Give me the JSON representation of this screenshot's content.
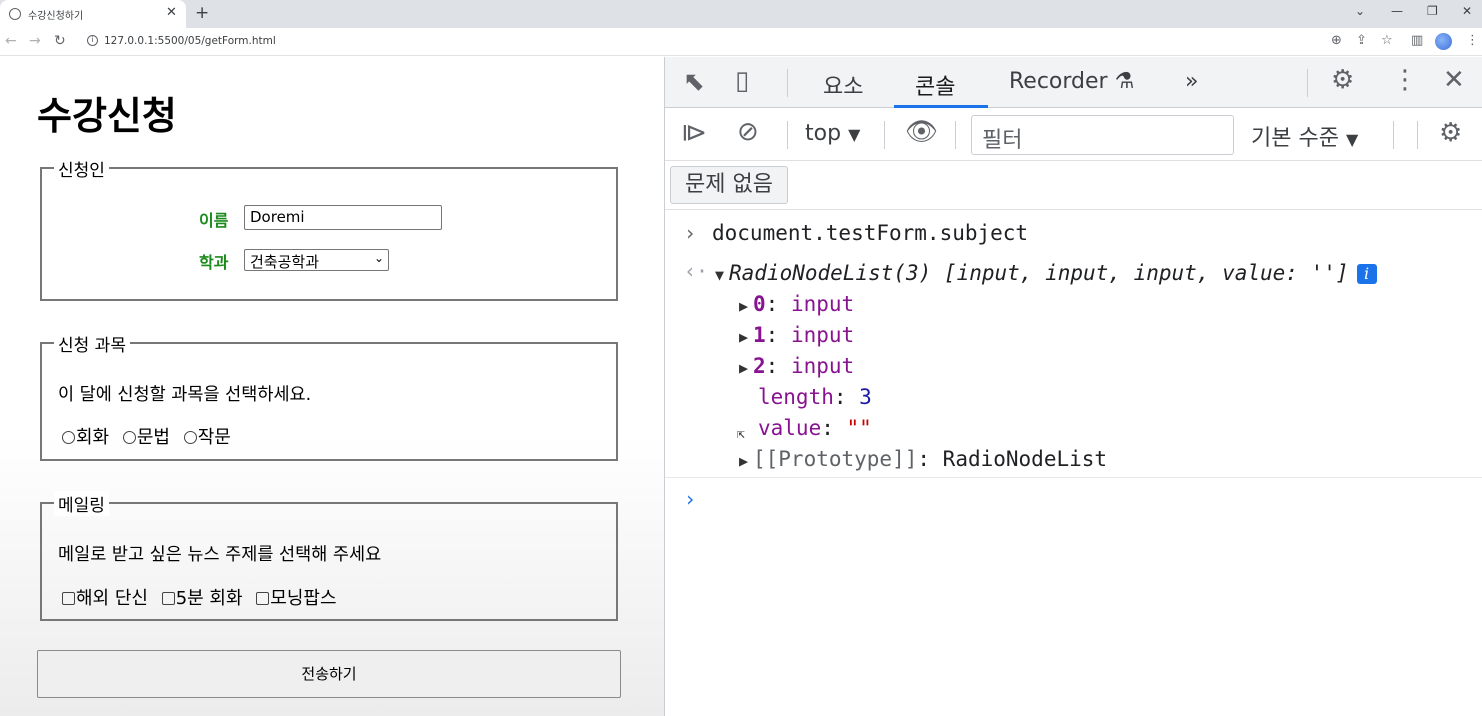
{
  "browser": {
    "tab_title": "수강신청하기",
    "url": "127.0.0.1:5500/05/getForm.html"
  },
  "page": {
    "title": "수강신청",
    "applicant": {
      "legend": "신청인",
      "name_label": "이름",
      "name_value": "Doremi",
      "dept_label": "학과",
      "dept_value": "건축공학과"
    },
    "subject": {
      "legend": "신청 과목",
      "prompt": "이 달에 신청할 과목을 선택하세요.",
      "options": [
        "회화",
        "문법",
        "작문"
      ]
    },
    "mailing": {
      "legend": "메일링",
      "prompt": "메일로 받고 싶은 뉴스 주제를 선택해 주세요",
      "options": [
        "해외 단신",
        "5분 회화",
        "모닝팝스"
      ]
    },
    "submit_label": "전송하기"
  },
  "devtools": {
    "tabs": [
      "요소",
      "콘솔",
      "Recorder"
    ],
    "active_tab": "콘솔",
    "more_tabs": "»",
    "context": "top",
    "filter_placeholder": "필터",
    "level": "기본 수준",
    "issues": "문제 없음",
    "console": {
      "command": "document.testForm.subject",
      "result_head": "RadioNodeList(3) [input, input, input, value: '']",
      "items": [
        {
          "key": "0",
          "value": "input"
        },
        {
          "key": "1",
          "value": "input"
        },
        {
          "key": "2",
          "value": "input"
        }
      ],
      "length_key": "length",
      "length_value": "3",
      "value_key": "value",
      "value_value": "\"\"",
      "prototype_key": "[[Prototype]]",
      "prototype_value": "RadioNodeList"
    }
  }
}
